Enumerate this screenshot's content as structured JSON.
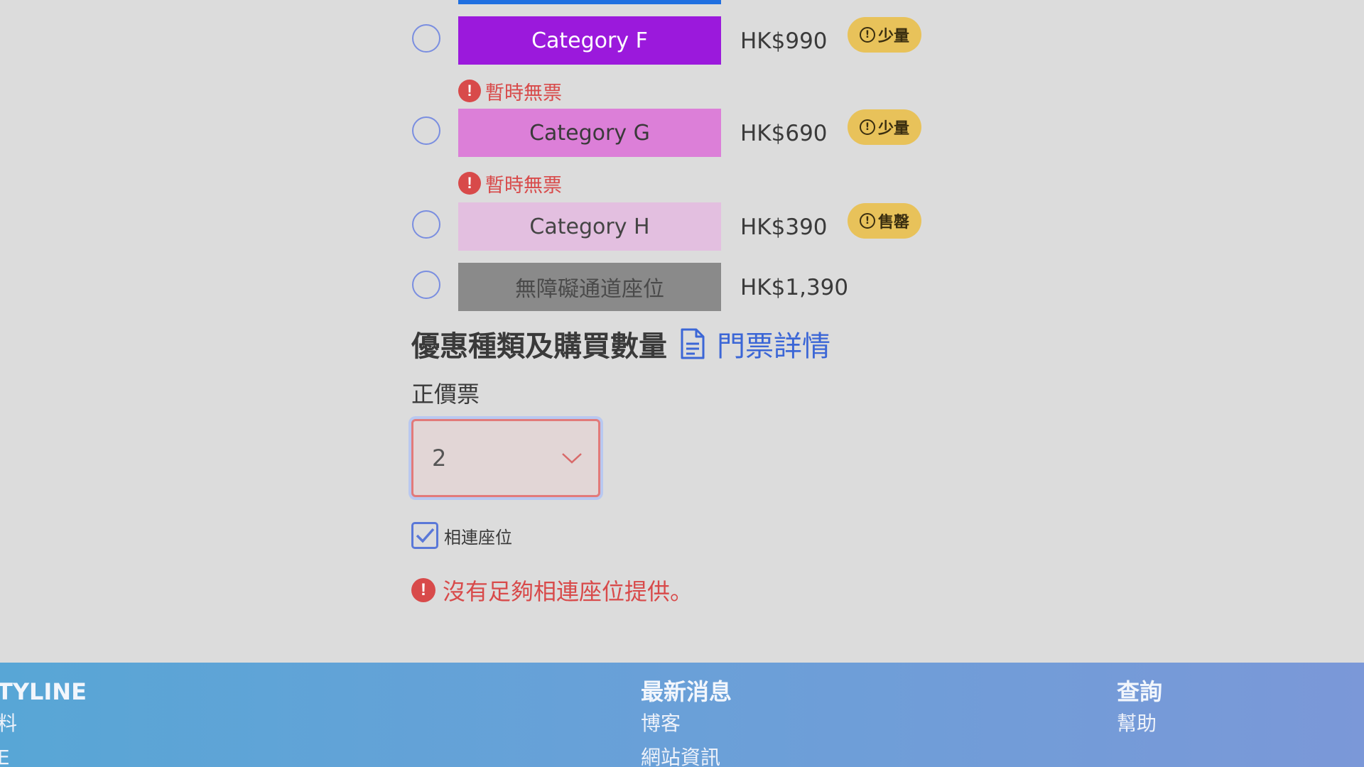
{
  "ticket_rows": [
    {
      "category": "Category F",
      "price": "HK$990",
      "bar_color": "#9b19dc",
      "text_color": "#ffffff",
      "badge": "少量",
      "unavailable_note": "暫時無票"
    },
    {
      "category": "Category G",
      "price": "HK$690",
      "bar_color": "#dc7fd8",
      "text_color": "#3a3a3a",
      "badge": "少量",
      "unavailable_note": "暫時無票"
    },
    {
      "category": "Category H",
      "price": "HK$390",
      "bar_color": "#e3bfe0",
      "text_color": "#444444",
      "badge": "售罄",
      "unavailable_note": ""
    },
    {
      "category": "無障礙通道座位",
      "price": "HK$1,390",
      "bar_color": "#8a8a8a",
      "text_color": "#4a4a4a",
      "badge": "",
      "unavailable_note": ""
    }
  ],
  "section": {
    "title": "優惠種類及購買數量",
    "details_link": "門票詳情",
    "ticket_type_label": "正價票",
    "quantity_value": "2",
    "contiguous_label": "相連座位",
    "contiguous_checked": true,
    "error_message": "沒有足夠相連座位提供。"
  },
  "footer": {
    "col1_heading": "TYLINE",
    "col1_links": [
      "料",
      "E"
    ],
    "col2_heading": "最新消息",
    "col2_links": [
      "博客",
      "網站資訊"
    ],
    "col3_heading": "查詢",
    "col3_links": [
      "幫助"
    ]
  },
  "colors": {
    "accent_blue": "#3b66d6",
    "error_red": "#d84a4a",
    "badge_yellow": "#e8c25a"
  }
}
